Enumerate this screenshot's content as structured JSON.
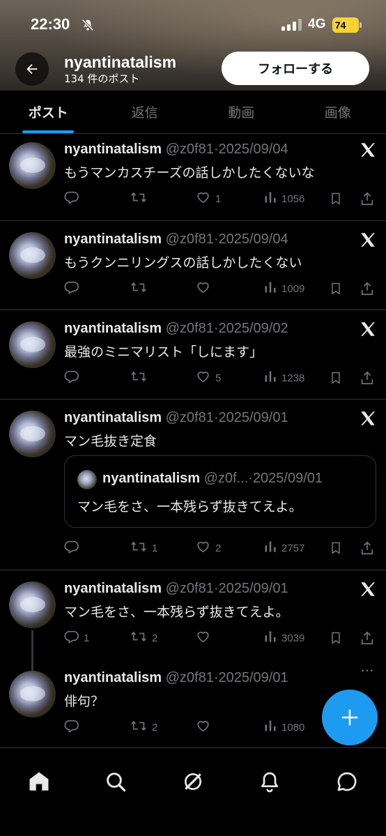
{
  "status_bar": {
    "time": "22:30",
    "network": "4G",
    "battery": "74"
  },
  "header": {
    "profile_name": "nyantinatalism",
    "post_count": "134 件のポスト",
    "follow_label": "フォローする"
  },
  "tabs": [
    {
      "label": "ポスト",
      "active": true
    },
    {
      "label": "返信",
      "active": false
    },
    {
      "label": "動画",
      "active": false
    },
    {
      "label": "画像",
      "active": false
    }
  ],
  "posts": [
    {
      "name": "nyantinatalism",
      "handle_date": "@z0f81·2025/09/04",
      "text": "もうマンカスチーズの話しかしたくないな",
      "replies": "",
      "reposts": "",
      "likes": "1",
      "views": "1056"
    },
    {
      "name": "nyantinatalism",
      "handle_date": "@z0f81·2025/09/04",
      "text": "もうクンニリングスの話しかしたくない",
      "replies": "",
      "reposts": "",
      "likes": "",
      "views": "1009"
    },
    {
      "name": "nyantinatalism",
      "handle_date": "@z0f81·2025/09/02",
      "text": "最強のミニマリスト「しにます」",
      "replies": "",
      "reposts": "",
      "likes": "5",
      "views": "1238"
    },
    {
      "name": "nyantinatalism",
      "handle_date": "@z0f81·2025/09/01",
      "text": "マン毛抜き定食",
      "replies": "",
      "reposts": "1",
      "likes": "2",
      "views": "2757",
      "quote": {
        "name": "nyantinatalism",
        "handle_date": "@z0f...·2025/09/01",
        "text": "マン毛をさ、一本残らず抜きてえよ。"
      }
    },
    {
      "name": "nyantinatalism",
      "handle_date": "@z0f81·2025/09/01",
      "text": "マン毛をさ、一本残らず抜きてえよ。",
      "replies": "1",
      "reposts": "2",
      "likes": "",
      "views": "3039"
    },
    {
      "name": "nyantinatalism",
      "handle_date": "@z0f81·2025/09/01",
      "text": "俳句？",
      "replies": "",
      "reposts": "2",
      "likes": "",
      "views": "1080"
    }
  ],
  "icons": {
    "back": "arrow-left-icon",
    "x_logo": "x-logo-icon",
    "more": "more-dots-icon",
    "reply": "reply-icon",
    "repost": "repost-icon",
    "like": "heart-icon",
    "views": "views-icon",
    "bookmark": "bookmark-icon",
    "share": "share-icon",
    "compose": "plus-icon",
    "nav": [
      "home-icon",
      "search-icon",
      "grok-icon",
      "bell-icon",
      "message-icon"
    ]
  },
  "colors": {
    "accent": "#1d9bf0",
    "muted": "#71767b",
    "text": "#e7e9ea",
    "background": "#000000",
    "battery": "#f6d435"
  }
}
